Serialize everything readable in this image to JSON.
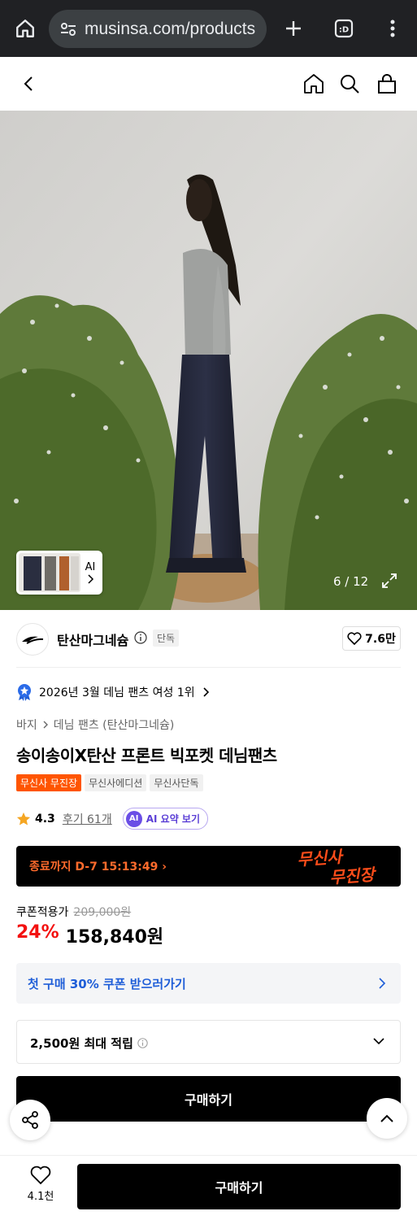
{
  "browser": {
    "url": "musinsa.com/products"
  },
  "gallery": {
    "counter": "6 / 12",
    "thumb_label": "AI"
  },
  "brand": {
    "name": "탄산마그네슘",
    "exclusive_badge": "단독",
    "like_count": "7.6만"
  },
  "ranking": {
    "text": "2026년 3월 데님 팬츠 여성 1위"
  },
  "category": {
    "level1": "바지",
    "level2": "데님 팬츠 (탄산마그네슘)"
  },
  "product": {
    "title": "송이송이X탄산 프론트 빅포켓 데님팬츠",
    "tags": [
      "무신사 무진장",
      "무신사에디션",
      "무신사단독"
    ]
  },
  "rating": {
    "score": "4.3",
    "reviews": "후기 61개",
    "ai_summary": "AI 요약 보기",
    "ai_badge": "AI"
  },
  "timer": {
    "text": "종료까지 D-7 15:13:49",
    "logo_line1": "무신사",
    "logo_line2": "무진장"
  },
  "price": {
    "label": "쿠폰적용가",
    "original": "209,000원",
    "discount": "24%",
    "final": "158,840원"
  },
  "coupon": {
    "text": "첫 구매 30% 쿠폰 받으러가기"
  },
  "points": {
    "text": "2,500원 최대 적립"
  },
  "buttons": {
    "buy_main": "구매하기",
    "buy_bottom": "구매하기",
    "wishlist_count": "4.1천"
  },
  "colors": {
    "accent_orange": "#ff5500",
    "discount_red": "#f31110",
    "coupon_blue": "#1f5ed8",
    "ai_purple": "#6a4ee6"
  }
}
